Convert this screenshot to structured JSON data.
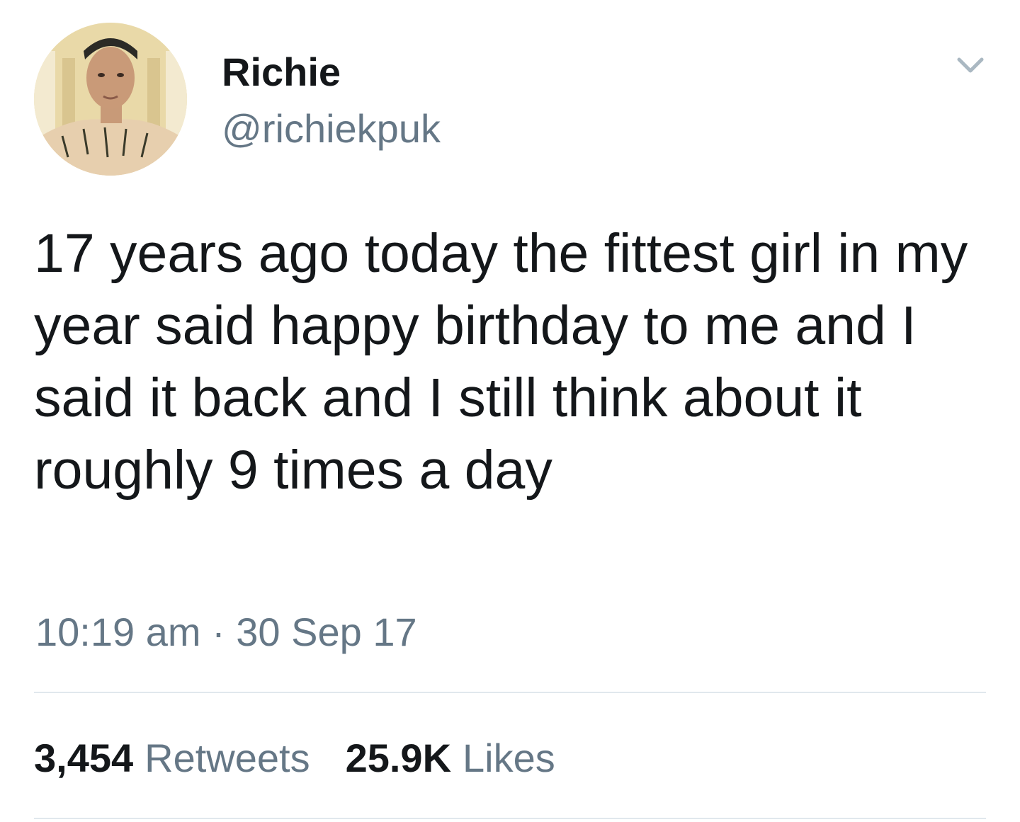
{
  "tweet": {
    "author": {
      "display_name": "Richie",
      "handle": "@richiekpuk"
    },
    "text": "17 years ago today the fittest girl in my year said happy birthday to me and I said it back and I still think about it roughly 9 times a day",
    "time": "10:19 am",
    "separator": "·",
    "date": "30 Sep 17"
  },
  "stats": {
    "retweets_count": "3,454",
    "retweets_label": "Retweets",
    "likes_count": "25.9K",
    "likes_label": "Likes"
  },
  "icons": {
    "menu": "chevron-down-icon"
  },
  "colors": {
    "text_primary": "#14171a",
    "text_secondary": "#657786",
    "divider": "#e1e8ed",
    "chevron": "#aab8c2"
  }
}
